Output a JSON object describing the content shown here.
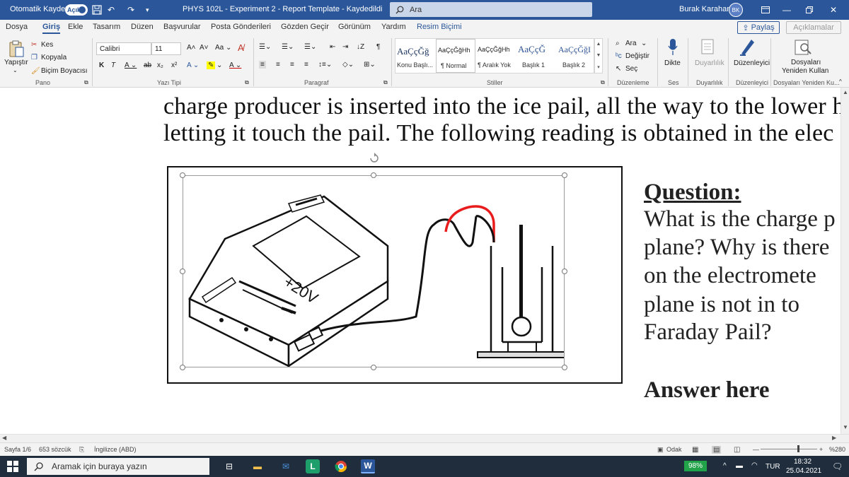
{
  "titlebar": {
    "autosave_label": "Otomatik Kaydet",
    "autosave_state": "Açık",
    "doc_title": "PHYS 102L - Experiment 2 - Report Template  -  Kaydedildi",
    "search_placeholder": "Ara",
    "user_name": "Burak Karahan",
    "user_initials": "BK"
  },
  "menu": {
    "tabs": [
      "Dosya",
      "Giriş",
      "Ekle",
      "Tasarım",
      "Düzen",
      "Başvurular",
      "Posta Gönderileri",
      "Gözden Geçir",
      "Görünüm",
      "Yardım",
      "Resim Biçimi"
    ],
    "share": "Paylaş",
    "comments": "Açıklamalar"
  },
  "ribbon": {
    "clipboard": {
      "paste": "Yapıştır",
      "cut": "Kes",
      "copy": "Kopyala",
      "format_painter": "Biçim Boyacısı",
      "group": "Pano"
    },
    "font": {
      "name": "Calibri",
      "size": "11",
      "group": "Yazı Tipi"
    },
    "paragraph": {
      "group": "Paragraf"
    },
    "styles": {
      "items": [
        {
          "preview": "AaÇçĞğ",
          "name": "Konu Başlı..."
        },
        {
          "preview": "AaÇçĞğHh",
          "name": "¶ Normal"
        },
        {
          "preview": "AaÇçĞğHh",
          "name": "¶ Aralık Yok"
        },
        {
          "preview": "AaÇçĞ",
          "name": "Başlık 1"
        },
        {
          "preview": "AaÇçĞğI",
          "name": "Başlık 2"
        }
      ],
      "group": "Stiller"
    },
    "editing": {
      "find": "Ara",
      "replace": "Değiştir",
      "select": "Seç",
      "group": "Düzenleme"
    },
    "voice": {
      "dictate": "Dikte",
      "group": "Ses"
    },
    "sensitivity": {
      "label": "Duyarlılık",
      "group": "Duyarlılık"
    },
    "editor": {
      "label": "Düzenleyici",
      "group": "Düzenleyici"
    },
    "reuse": {
      "label1": "Dosyaları",
      "label2": "Yeniden Kullan",
      "group": "Dosyaları Yeniden Ku..."
    }
  },
  "document": {
    "line1": "charge producer is inserted into the ice pail, all the way to the lower h",
    "line2": "letting it touch the pail. The following reading is obtained in the elec",
    "question_title": "Question:",
    "question_lines": [
      "What is the charge p",
      "plane? Why is there",
      "on  the  electromete",
      "plane  is  not  in  to",
      "Faraday Pail?"
    ],
    "answer": "Answer here",
    "figure": {
      "reading": "+20V"
    }
  },
  "status": {
    "page": "Sayfa 1/6",
    "words": "653 sözcük",
    "language": "İngilizce (ABD)",
    "focus": "Odak",
    "zoom": "%280"
  },
  "taskbar": {
    "search_placeholder": "Aramak için buraya yazın",
    "battery": "98%",
    "lang": "TUR",
    "time": "18:32",
    "date": "25.04.2021"
  }
}
